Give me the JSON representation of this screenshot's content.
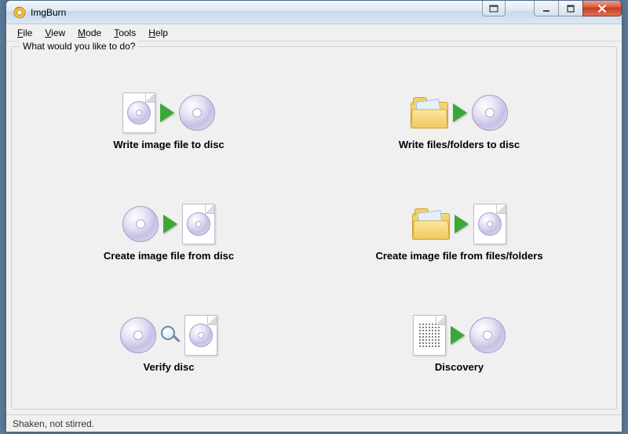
{
  "title": "ImgBurn",
  "menu": {
    "file": "File",
    "view": "View",
    "mode": "Mode",
    "tools": "Tools",
    "help": "Help"
  },
  "group_label": "What would you like to do?",
  "actions": {
    "write_image_to_disc": "Write image file to disc",
    "write_files_to_disc": "Write files/folders to disc",
    "create_image_from_disc": "Create image file from disc",
    "create_image_from_files": "Create image file from files/folders",
    "verify_disc": "Verify disc",
    "discovery": "Discovery"
  },
  "status": "Shaken, not stirred."
}
